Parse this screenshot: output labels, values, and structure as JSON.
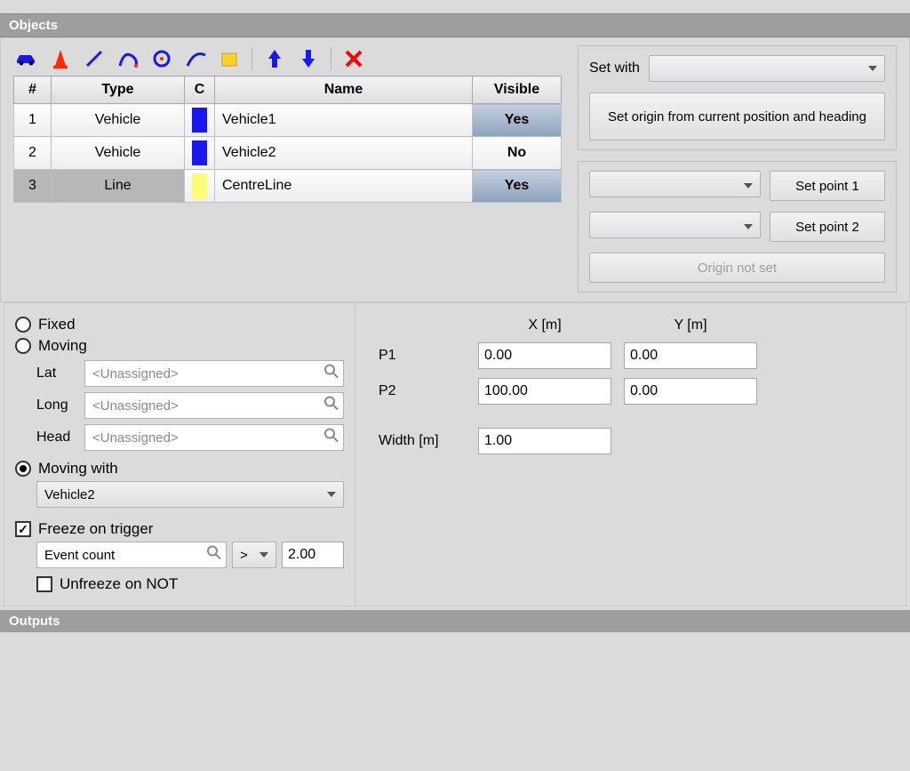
{
  "panels": {
    "objects": "Objects",
    "outputs": "Outputs"
  },
  "toolbar_icons": [
    "car",
    "cone",
    "line",
    "curve",
    "circle",
    "arc",
    "polygon",
    "arrow-up",
    "arrow-down",
    "delete"
  ],
  "table": {
    "headers": {
      "num": "#",
      "type": "Type",
      "c": "C",
      "name": "Name",
      "visible": "Visible"
    },
    "rows": [
      {
        "num": "1",
        "type": "Vehicle",
        "color": "#1818ef",
        "name": "Vehicle1",
        "visible": "Yes",
        "vis_yes": true,
        "selected": false
      },
      {
        "num": "2",
        "type": "Vehicle",
        "color": "#1818ef",
        "name": "Vehicle2",
        "visible": "No",
        "vis_yes": false,
        "selected": false
      },
      {
        "num": "3",
        "type": "Line",
        "color": "#fbfb78",
        "name": "CentreLine",
        "visible": "Yes",
        "vis_yes": true,
        "selected": true
      }
    ]
  },
  "setwith": {
    "label": "Set with",
    "origin_btn": "Set origin from current position and heading",
    "point1_btn": "Set point 1",
    "point2_btn": "Set point 2",
    "origin_status": "Origin not set"
  },
  "mode": {
    "fixed": "Fixed",
    "moving": "Moving",
    "moving_with": "Moving with",
    "lat": "Lat",
    "long": "Long",
    "head": "Head",
    "unassigned": "<Unassigned>",
    "moving_with_value": "Vehicle2",
    "freeze": "Freeze on trigger",
    "freeze_source": "Event count",
    "freeze_op": ">",
    "freeze_value": "2.00",
    "unfreeze": "Unfreeze on NOT",
    "selected": "moving_with",
    "freeze_checked": true,
    "unfreeze_checked": false
  },
  "coords": {
    "x_hdr": "X [m]",
    "y_hdr": "Y [m]",
    "p1": "P1",
    "p2": "P2",
    "width_lbl": "Width [m]",
    "p1x": "0.00",
    "p1y": "0.00",
    "p2x": "100.00",
    "p2y": "0.00",
    "width": "1.00"
  }
}
